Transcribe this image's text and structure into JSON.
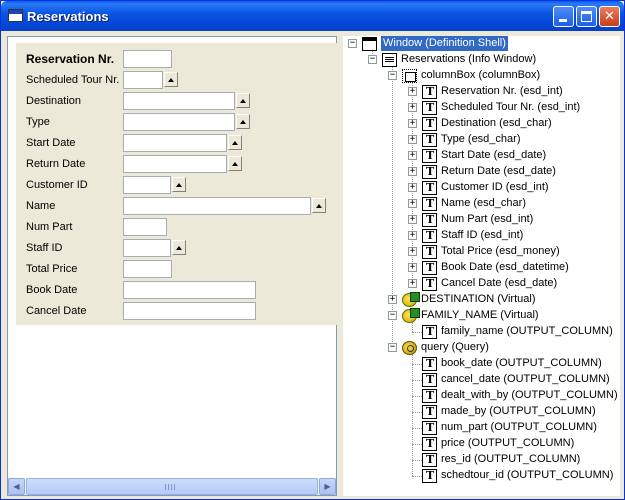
{
  "window": {
    "title": "Reservations"
  },
  "form": {
    "fields": [
      {
        "label": "Reservation Nr.",
        "bold": true,
        "input_width": 49,
        "spin": false
      },
      {
        "label": "Scheduled Tour Nr.",
        "bold": false,
        "input_width": 40,
        "spin": true
      },
      {
        "label": "Destination",
        "bold": false,
        "input_width": 112,
        "spin": true
      },
      {
        "label": "Type",
        "bold": false,
        "input_width": 112,
        "spin": true
      },
      {
        "label": "Start Date",
        "bold": false,
        "input_width": 104,
        "spin": true
      },
      {
        "label": "Return Date",
        "bold": false,
        "input_width": 104,
        "spin": true
      },
      {
        "label": "Customer ID",
        "bold": false,
        "input_width": 48,
        "spin": true
      },
      {
        "label": "Name",
        "bold": false,
        "input_width": 188,
        "spin": true
      },
      {
        "label": "Num Part",
        "bold": false,
        "input_width": 44,
        "spin": false
      },
      {
        "label": "Staff ID",
        "bold": false,
        "input_width": 48,
        "spin": true
      },
      {
        "label": "Total Price",
        "bold": false,
        "input_width": 49,
        "spin": false
      },
      {
        "label": "Book Date",
        "bold": false,
        "input_width": 133,
        "spin": false
      },
      {
        "label": "Cancel Date",
        "bold": false,
        "input_width": 133,
        "spin": false
      }
    ]
  },
  "tree": {
    "nodes": [
      {
        "label": "Window (Definition Shell)",
        "icon": "window-icon",
        "level": 0,
        "expander": "−",
        "selected": true
      },
      {
        "label": "Reservations (Info Window)",
        "icon": "info-window-icon",
        "level": 1,
        "expander": "−"
      },
      {
        "label": "columnBox (columnBox)",
        "icon": "column-box-icon",
        "level": 2,
        "expander": "−"
      },
      {
        "label": "Reservation Nr. (esd_int)",
        "icon": "field-icon",
        "level": 3,
        "expander": "+"
      },
      {
        "label": "Scheduled Tour Nr. (esd_int)",
        "icon": "field-icon",
        "level": 3,
        "expander": "+"
      },
      {
        "label": "Destination (esd_char)",
        "icon": "field-icon",
        "level": 3,
        "expander": "+"
      },
      {
        "label": "Type (esd_char)",
        "icon": "field-icon",
        "level": 3,
        "expander": "+"
      },
      {
        "label": "Start Date (esd_date)",
        "icon": "field-icon",
        "level": 3,
        "expander": "+"
      },
      {
        "label": "Return Date (esd_date)",
        "icon": "field-icon",
        "level": 3,
        "expander": "+"
      },
      {
        "label": "Customer ID (esd_int)",
        "icon": "field-icon",
        "level": 3,
        "expander": "+"
      },
      {
        "label": "Name (esd_char)",
        "icon": "field-icon",
        "level": 3,
        "expander": "+"
      },
      {
        "label": "Num Part (esd_int)",
        "icon": "field-icon",
        "level": 3,
        "expander": "+"
      },
      {
        "label": "Staff ID (esd_int)",
        "icon": "field-icon",
        "level": 3,
        "expander": "+"
      },
      {
        "label": "Total Price (esd_money)",
        "icon": "field-icon",
        "level": 3,
        "expander": "+"
      },
      {
        "label": "Book Date (esd_datetime)",
        "icon": "field-icon",
        "level": 3,
        "expander": "+"
      },
      {
        "label": "Cancel Date (esd_date)",
        "icon": "field-icon",
        "level": 3,
        "expander": "+"
      },
      {
        "label": "DESTINATION (Virtual)",
        "icon": "virtual-icon",
        "level": 2,
        "expander": "+"
      },
      {
        "label": "FAMILY_NAME (Virtual)",
        "icon": "virtual-icon",
        "level": 2,
        "expander": "−"
      },
      {
        "label": "family_name (OUTPUT_COLUMN)",
        "icon": "field-icon",
        "level": 3,
        "expander": ""
      },
      {
        "label": "query (Query)",
        "icon": "query-icon",
        "level": 2,
        "expander": "−"
      },
      {
        "label": "book_date (OUTPUT_COLUMN)",
        "icon": "field-icon",
        "level": 3,
        "expander": ""
      },
      {
        "label": "cancel_date (OUTPUT_COLUMN)",
        "icon": "field-icon",
        "level": 3,
        "expander": ""
      },
      {
        "label": "dealt_with_by (OUTPUT_COLUMN)",
        "icon": "field-icon",
        "level": 3,
        "expander": ""
      },
      {
        "label": "made_by (OUTPUT_COLUMN)",
        "icon": "field-icon",
        "level": 3,
        "expander": ""
      },
      {
        "label": "num_part (OUTPUT_COLUMN)",
        "icon": "field-icon",
        "level": 3,
        "expander": ""
      },
      {
        "label": "price (OUTPUT_COLUMN)",
        "icon": "field-icon",
        "level": 3,
        "expander": ""
      },
      {
        "label": "res_id (OUTPUT_COLUMN)",
        "icon": "field-icon",
        "level": 3,
        "expander": ""
      },
      {
        "label": "schedtour_id (OUTPUT_COLUMN)",
        "icon": "field-icon",
        "level": 3,
        "expander": ""
      }
    ]
  },
  "colors": {
    "title_bar": "#0a55e3",
    "selection": "#316ac5",
    "form_bg": "#ece9d8"
  }
}
